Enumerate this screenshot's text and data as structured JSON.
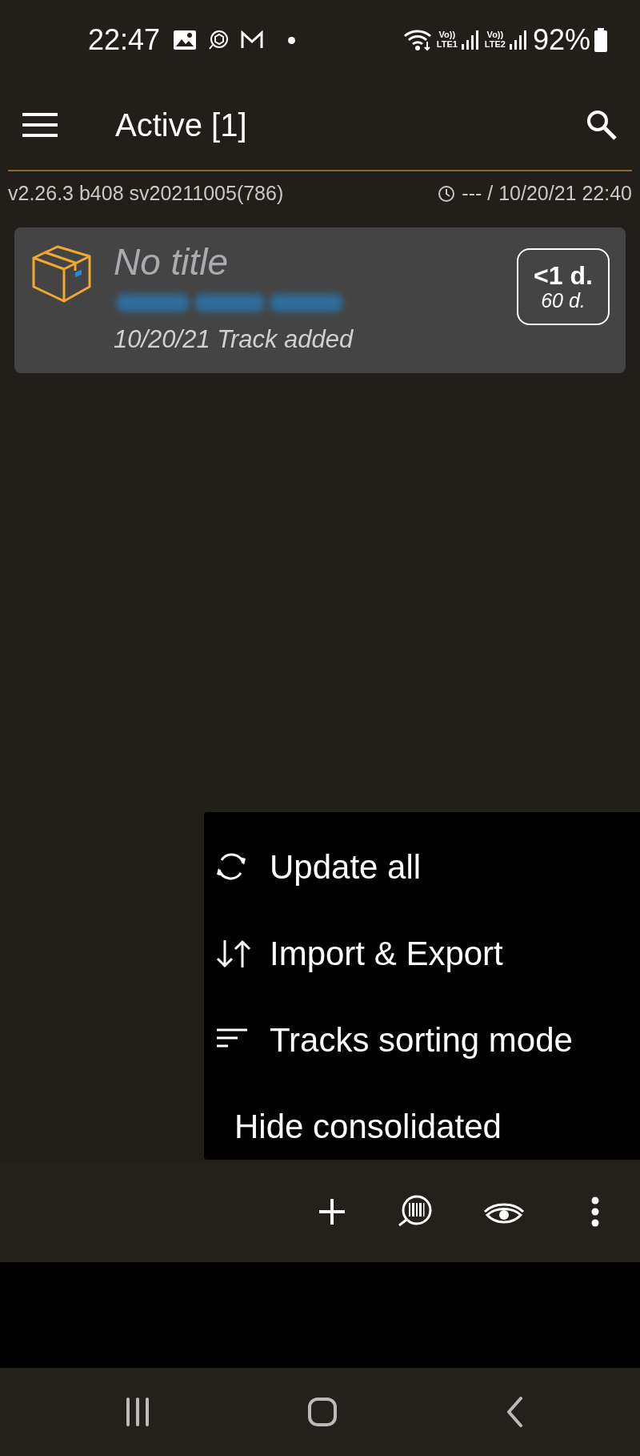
{
  "status_bar": {
    "time": "22:47",
    "networks": [
      {
        "top": "Vo))",
        "bottom": "LTE1"
      },
      {
        "top": "Vo))",
        "bottom": "LTE2"
      }
    ],
    "battery": "92%"
  },
  "toolbar": {
    "title": "Active [1]"
  },
  "info_bar": {
    "version": "v2.26.3 b408 sv20211005(786)",
    "sync": "--- / 10/20/21 22:40"
  },
  "tracks": [
    {
      "title": "No title",
      "event": "10/20/21 Track added",
      "age": "<1 d.",
      "limit": "60 d."
    }
  ],
  "menu": [
    {
      "label": "Update all",
      "kind": "refresh"
    },
    {
      "label": "Import & Export",
      "kind": "transfer"
    },
    {
      "label": "Tracks sorting mode",
      "kind": "sort"
    },
    {
      "label": "Hide consolidated",
      "kind": "plain"
    }
  ]
}
